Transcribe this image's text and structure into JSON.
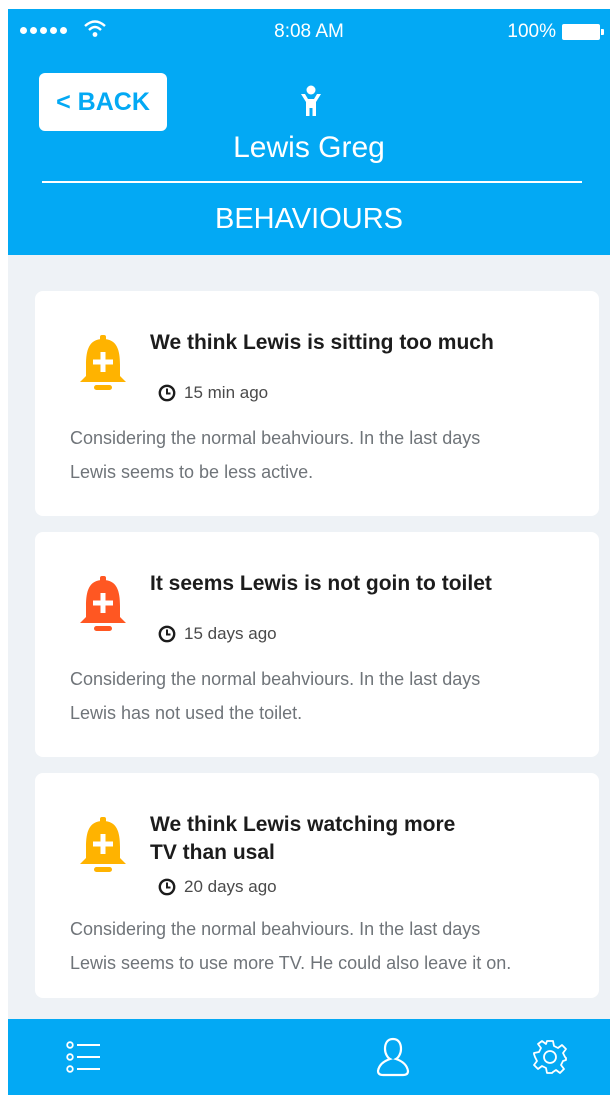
{
  "status_bar": {
    "time": "8:08 AM",
    "battery": "100%"
  },
  "header": {
    "back_label": "< BACK",
    "patient_name": "Lewis Greg",
    "section_title": "BEHAVIOURS",
    "person_icon": "person-icon"
  },
  "colors": {
    "primary": "#03a9f4",
    "warning": "#ffb300",
    "alert": "#ff5722",
    "background": "#eef2f6"
  },
  "cards": [
    {
      "title_lines": [
        "We think Lewis is sitting too much"
      ],
      "time": "15 min ago",
      "desc_lines": [
        "Considering the normal beahviours. In the last days",
        "Lewis seems to be less active."
      ],
      "severity": "warning"
    },
    {
      "title_lines": [
        "It seems Lewis is not goin to toilet"
      ],
      "time": "15 days ago",
      "desc_lines": [
        "Considering the normal beahviours. In the last days",
        "Lewis has not used the toilet."
      ],
      "severity": "alert"
    },
    {
      "title_lines": [
        "We think Lewis watching more",
        "TV than usal"
      ],
      "time": "20 days ago",
      "desc_lines": [
        "Considering the normal beahviours. In the last days",
        "Lewis seems to use more TV. He could also leave it on."
      ],
      "severity": "warning"
    }
  ],
  "bottom_nav": {
    "items": [
      "list-icon",
      "user-icon",
      "gear-icon"
    ]
  }
}
